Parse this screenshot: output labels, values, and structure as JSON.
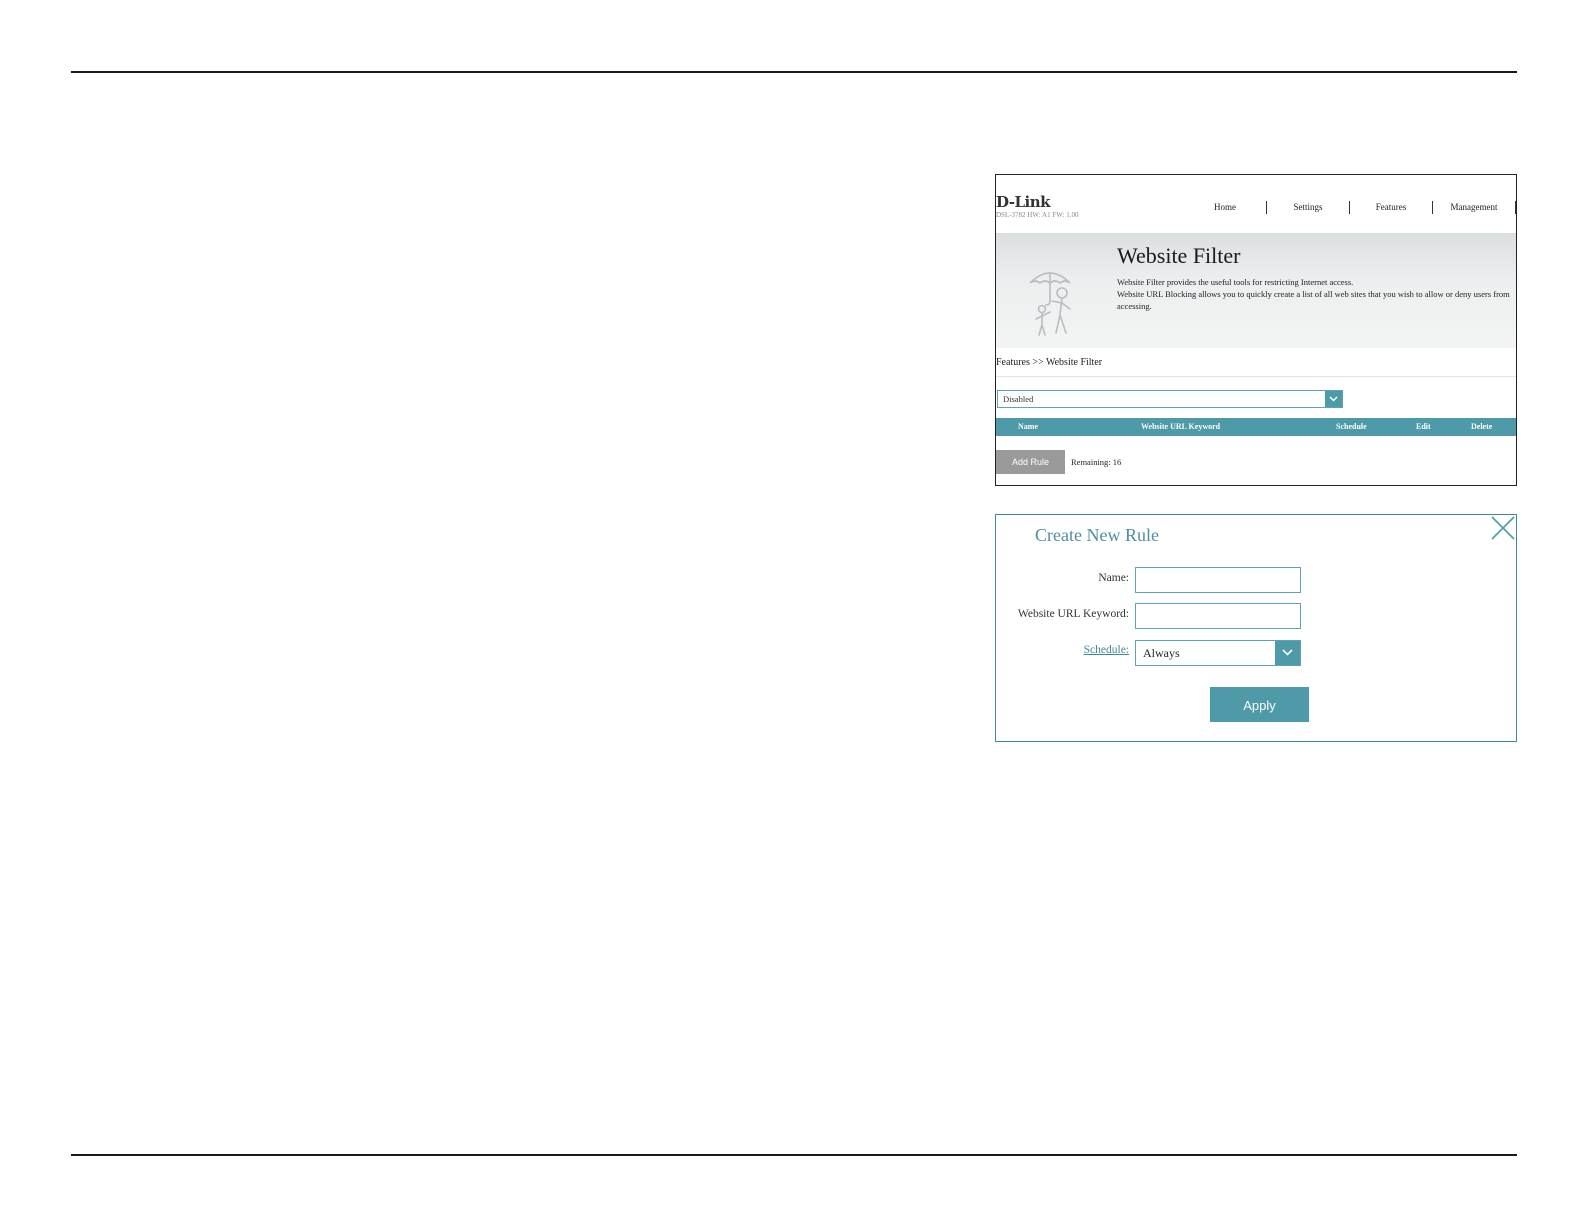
{
  "router_page": {
    "logo": "D-Link",
    "model_info": "DSL-3782 HW: A1 FW: 1.00",
    "nav": [
      "Home",
      "Settings",
      "Features",
      "Management"
    ],
    "title": "Website Filter",
    "description_line1": "Website Filter provides the useful tools for restricting Internet access.",
    "description_line2": "Website URL Blocking allows you to quickly create a list of all web sites that you wish to allow or deny users from accessing.",
    "breadcrumb": "Features >> Website Filter",
    "filter_status": "Disabled",
    "table_headers": [
      "Name",
      "Website URL Keyword",
      "Schedule",
      "Edit",
      "Delete"
    ],
    "add_rule_label": "Add Rule",
    "remaining_text": "Remaining: 16"
  },
  "create_rule_dialog": {
    "title": "Create New Rule",
    "name_label": "Name:",
    "url_label": "Website URL Keyword:",
    "schedule_label": "Schedule:",
    "name_value": "",
    "url_value": "",
    "schedule_value": "Always",
    "apply_label": "Apply"
  },
  "colors": {
    "accent": "#4e9aa9",
    "title_teal": "#4e8fa0",
    "button_gray": "#9a9a9a"
  },
  "icons": [
    "umbrella-family-icon",
    "chevron-down-icon",
    "close-icon"
  ]
}
